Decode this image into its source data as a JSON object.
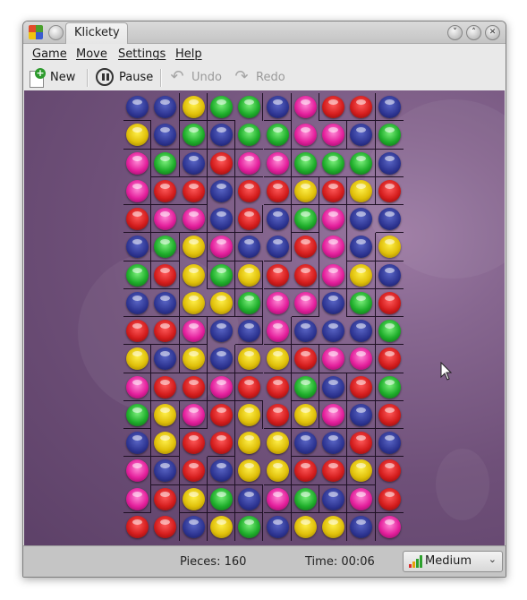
{
  "window": {
    "title": "Klickety"
  },
  "menubar": {
    "items": [
      "Game",
      "Move",
      "Settings",
      "Help"
    ]
  },
  "toolbar": {
    "new_label": "New",
    "pause_label": "Pause",
    "undo_label": "Undo",
    "redo_label": "Redo"
  },
  "status": {
    "pieces": "Pieces: 160",
    "time": "Time: 00:06",
    "difficulty": "Medium"
  },
  "colors": {
    "b": "#2c3390",
    "y": "#e0c00a",
    "g": "#1fae2b",
    "r": "#d41d1d",
    "m": "#e41f9c"
  },
  "board": {
    "columns": 10,
    "rows": 16,
    "cells": [
      "bbyggbmrrb",
      "ybgbggmmbg",
      "mgbrmmgggb",
      "mrrbrryryr",
      "rmmbrbgmbb",
      "bgymbbrmby",
      "grygyrrmyb",
      "bbyygmmbgr",
      "rrmbbmbbbg",
      "ybybyyrmmr",
      "mrrmrrgbrg",
      "gymryrymbr",
      "byrryybbrb",
      "mbrbyyrryr",
      "mrygbmgbmr",
      "rrbygbyybm"
    ]
  }
}
